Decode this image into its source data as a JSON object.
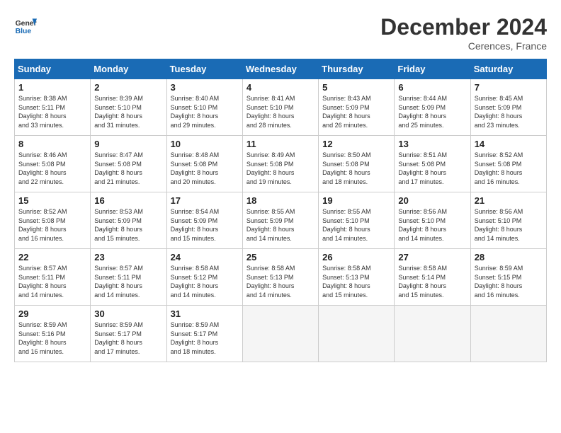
{
  "header": {
    "logo_line1": "General",
    "logo_line2": "Blue",
    "title": "December 2024",
    "subtitle": "Cerences, France"
  },
  "weekdays": [
    "Sunday",
    "Monday",
    "Tuesday",
    "Wednesday",
    "Thursday",
    "Friday",
    "Saturday"
  ],
  "weeks": [
    [
      {
        "day": "1",
        "sunrise": "8:38 AM",
        "sunset": "5:11 PM",
        "daylight": "8 hours and 33 minutes."
      },
      {
        "day": "2",
        "sunrise": "8:39 AM",
        "sunset": "5:10 PM",
        "daylight": "8 hours and 31 minutes."
      },
      {
        "day": "3",
        "sunrise": "8:40 AM",
        "sunset": "5:10 PM",
        "daylight": "8 hours and 29 minutes."
      },
      {
        "day": "4",
        "sunrise": "8:41 AM",
        "sunset": "5:10 PM",
        "daylight": "8 hours and 28 minutes."
      },
      {
        "day": "5",
        "sunrise": "8:43 AM",
        "sunset": "5:09 PM",
        "daylight": "8 hours and 26 minutes."
      },
      {
        "day": "6",
        "sunrise": "8:44 AM",
        "sunset": "5:09 PM",
        "daylight": "8 hours and 25 minutes."
      },
      {
        "day": "7",
        "sunrise": "8:45 AM",
        "sunset": "5:09 PM",
        "daylight": "8 hours and 23 minutes."
      }
    ],
    [
      {
        "day": "8",
        "sunrise": "8:46 AM",
        "sunset": "5:08 PM",
        "daylight": "8 hours and 22 minutes."
      },
      {
        "day": "9",
        "sunrise": "8:47 AM",
        "sunset": "5:08 PM",
        "daylight": "8 hours and 21 minutes."
      },
      {
        "day": "10",
        "sunrise": "8:48 AM",
        "sunset": "5:08 PM",
        "daylight": "8 hours and 20 minutes."
      },
      {
        "day": "11",
        "sunrise": "8:49 AM",
        "sunset": "5:08 PM",
        "daylight": "8 hours and 19 minutes."
      },
      {
        "day": "12",
        "sunrise": "8:50 AM",
        "sunset": "5:08 PM",
        "daylight": "8 hours and 18 minutes."
      },
      {
        "day": "13",
        "sunrise": "8:51 AM",
        "sunset": "5:08 PM",
        "daylight": "8 hours and 17 minutes."
      },
      {
        "day": "14",
        "sunrise": "8:52 AM",
        "sunset": "5:08 PM",
        "daylight": "8 hours and 16 minutes."
      }
    ],
    [
      {
        "day": "15",
        "sunrise": "8:52 AM",
        "sunset": "5:08 PM",
        "daylight": "8 hours and 16 minutes."
      },
      {
        "day": "16",
        "sunrise": "8:53 AM",
        "sunset": "5:09 PM",
        "daylight": "8 hours and 15 minutes."
      },
      {
        "day": "17",
        "sunrise": "8:54 AM",
        "sunset": "5:09 PM",
        "daylight": "8 hours and 15 minutes."
      },
      {
        "day": "18",
        "sunrise": "8:55 AM",
        "sunset": "5:09 PM",
        "daylight": "8 hours and 14 minutes."
      },
      {
        "day": "19",
        "sunrise": "8:55 AM",
        "sunset": "5:10 PM",
        "daylight": "8 hours and 14 minutes."
      },
      {
        "day": "20",
        "sunrise": "8:56 AM",
        "sunset": "5:10 PM",
        "daylight": "8 hours and 14 minutes."
      },
      {
        "day": "21",
        "sunrise": "8:56 AM",
        "sunset": "5:10 PM",
        "daylight": "8 hours and 14 minutes."
      }
    ],
    [
      {
        "day": "22",
        "sunrise": "8:57 AM",
        "sunset": "5:11 PM",
        "daylight": "8 hours and 14 minutes."
      },
      {
        "day": "23",
        "sunrise": "8:57 AM",
        "sunset": "5:11 PM",
        "daylight": "8 hours and 14 minutes."
      },
      {
        "day": "24",
        "sunrise": "8:58 AM",
        "sunset": "5:12 PM",
        "daylight": "8 hours and 14 minutes."
      },
      {
        "day": "25",
        "sunrise": "8:58 AM",
        "sunset": "5:13 PM",
        "daylight": "8 hours and 14 minutes."
      },
      {
        "day": "26",
        "sunrise": "8:58 AM",
        "sunset": "5:13 PM",
        "daylight": "8 hours and 15 minutes."
      },
      {
        "day": "27",
        "sunrise": "8:58 AM",
        "sunset": "5:14 PM",
        "daylight": "8 hours and 15 minutes."
      },
      {
        "day": "28",
        "sunrise": "8:59 AM",
        "sunset": "5:15 PM",
        "daylight": "8 hours and 16 minutes."
      }
    ],
    [
      {
        "day": "29",
        "sunrise": "8:59 AM",
        "sunset": "5:16 PM",
        "daylight": "8 hours and 16 minutes."
      },
      {
        "day": "30",
        "sunrise": "8:59 AM",
        "sunset": "5:17 PM",
        "daylight": "8 hours and 17 minutes."
      },
      {
        "day": "31",
        "sunrise": "8:59 AM",
        "sunset": "5:17 PM",
        "daylight": "8 hours and 18 minutes."
      },
      null,
      null,
      null,
      null
    ]
  ]
}
